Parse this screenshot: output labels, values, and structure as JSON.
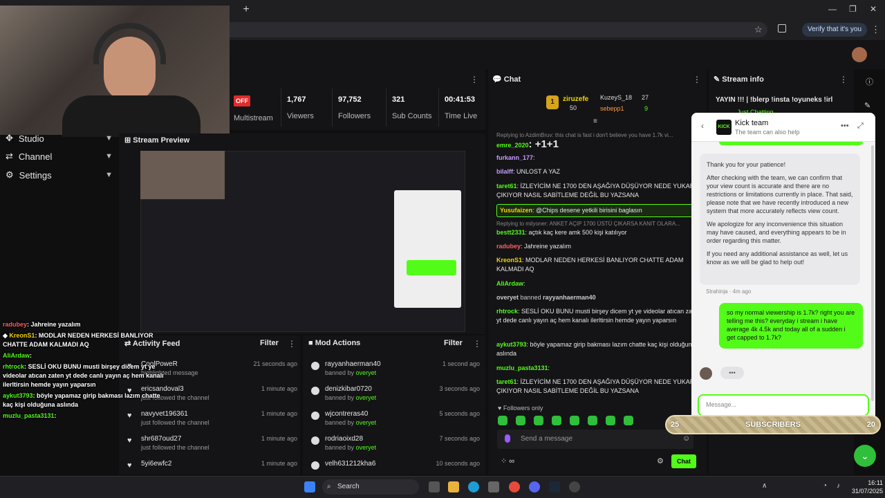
{
  "browser": {
    "new_tab": "+",
    "verify_label": "Verify that it's you",
    "min": "—",
    "max": "❐",
    "close": "✕"
  },
  "nav": {
    "items": [
      {
        "label": "Studio"
      },
      {
        "label": "Channel"
      },
      {
        "label": "Settings"
      }
    ]
  },
  "stats": {
    "status": "OFF",
    "multistream_label": "Multistream",
    "viewers": "1,767",
    "viewers_label": "Viewers",
    "followers": "97,752",
    "followers_label": "Followers",
    "subs": "321",
    "subs_label": "Sub Counts",
    "time": "00:41:53",
    "time_label": "Time Live"
  },
  "preview": {
    "title": "Stream Preview"
  },
  "activity": {
    "title": "Activity Feed",
    "filter": "Filter",
    "rows": [
      {
        "name": "CoolPoweR",
        "sub": "highlighted message",
        "time": "21 seconds ago"
      },
      {
        "name": "ericsandoval3",
        "sub": "just followed the channel",
        "time": "1 minute ago"
      },
      {
        "name": "navyvet196361",
        "sub": "just followed the channel",
        "time": "1 minute ago"
      },
      {
        "name": "shr687oud27",
        "sub": "just followed the channel",
        "time": "1 minute ago"
      },
      {
        "name": "5yi6ewfc2",
        "sub": "",
        "time": "1 minute ago"
      }
    ]
  },
  "mod": {
    "title": "Mod Actions",
    "filter": "Filter",
    "banned_by": "banned by",
    "moderator": "overyet",
    "rows": [
      {
        "name": "rayyanhaerman40",
        "time": "1 second ago"
      },
      {
        "name": "denizkibar0720",
        "time": "3 seconds ago"
      },
      {
        "name": "wjcontreras40",
        "time": "5 seconds ago"
      },
      {
        "name": "rodriaoixd28",
        "time": "7 seconds ago"
      },
      {
        "name": "velh631212kha6",
        "time": "10 seconds ago"
      }
    ]
  },
  "overlay": [
    {
      "user": "radubey",
      "text": ": Jahreine yazalım"
    },
    {
      "user": "KreonS1",
      "text": ": MODLAR NEDEN HERKESİ BANLIYOR CHATTE ADAM KALMADI AQ"
    },
    {
      "user": "AliArdaw",
      "text": ":"
    },
    {
      "user": "rhtrock",
      "text": ": SESLİ OKU BUNU musti birşey dicem yt ye videolar atıcan zaten yt dede canlı yayın aç hem kanalı ilerltirsin hemde yayın yaparsın"
    },
    {
      "user": "aykut3793",
      "text": ": böyle yapamaz girip bakması lazım chatte kaç kişi olduğuna aslında"
    },
    {
      "user": "muzlu_pasta3131",
      "text": ":"
    }
  ],
  "chat": {
    "title": "Chat",
    "top": [
      {
        "rank": "1",
        "name": "ziruzefe",
        "count": "50"
      },
      {
        "rank": "",
        "name": "KuzeyS_18",
        "count": "27"
      },
      {
        "rank": "",
        "name": "sebepp1",
        "count": "9"
      }
    ],
    "messages": [
      {
        "reply": "Replying to AzdimBruv: this chat is fast i don't believe you have 1.7k vi...",
        "user": "emre_2020",
        "text": ": +1+1"
      },
      {
        "user": "furkann_177",
        "text": ":"
      },
      {
        "user": "bilalff",
        "text": ": UNLOST A YAZ"
      },
      {
        "user": "taret61",
        "text": ": İZLEYİCİM NE 1700 DEN AŞAĞIYA DÜŞÜYOR NEDE YUKARI ÇIKIYOR NASIL SABİTLEME DEĞİL BU YAZSANA"
      },
      {
        "user": "Yusufaizen",
        "text": ": @Chips desene yetkili birisini baglasın",
        "highlight": true
      },
      {
        "reply": "Replying to milyoner: ANKET AÇIP 1700 ÜSTÜ ÇIKARSA KANIT OLARA...",
        "user": "bestt2331",
        "text": ": açtık kaç kere amk 500 kişi katılıyor"
      },
      {
        "user": "radubey",
        "text": ": Jahreine yazalım"
      },
      {
        "user": "KreonS1",
        "text": ": MODLAR NEDEN HERKESİ BANLIYOR CHATTE ADAM KALMADI AQ"
      },
      {
        "user": "AliArdaw",
        "text": ":"
      },
      {
        "system": true,
        "user": "overyet",
        "text": "banned",
        "target": "rayyanhaerman40"
      },
      {
        "user": "rhtrock",
        "text": ": SESLİ OKU BUNU musti birşey dicem yt ye videolar atıcan zaten yt dede canlı yayın aç hem kanalı ilerltirsin hemde yayın yaparsın"
      },
      {
        "user": "aykut3793",
        "text": ": böyle yapamaz girip bakması lazım chatte kaç kişi olduğuna aslında"
      },
      {
        "user": "muzlu_pasta3131",
        "text": ":"
      },
      {
        "user": "taret61",
        "text": ": İZLEYİCİM NE 1700 DEN AŞAĞIYA DÜŞÜYOR NEDE YUKARI ÇIKIYOR NASIL SABİTLEME DEĞİL BU YAZSANA"
      }
    ],
    "followers_only": "Followers only",
    "send_placeholder": "Send a message",
    "chat_button": "Chat"
  },
  "info": {
    "title": "Stream info",
    "stream_title": "YAYIN !!! | !blerp !insta !oyuneks !irl",
    "category": "Just Chatting"
  },
  "widget": {
    "title": "Kick team",
    "subtitle": "The team can also help",
    "logo": "KICK",
    "reply": [
      "Thank you for your patience!",
      "After checking with the team, we can confirm that your view count is accurate and there are no restrictions or limitations currently in place. That said, please note that we have recently introduced a new system that more accurately reflects view count.",
      "We apologize for any inconvenience this situation may have caused, and everything appears to be in order regarding this matter.",
      "If you need any additional assistance as well, let us know as we will be glad to help out!"
    ],
    "meta": "Strahinja · 4m ago",
    "user_msg": "so my normal viewership is 1.7k? right you are telling me this? everyday i stream i have average 4k 4.5k and today all of a sudden i get capped to 1.7k?",
    "typing": "•••",
    "input_placeholder": "Message..."
  },
  "subs": {
    "left": "25",
    "label": "SUBSCRIBERS",
    "right": "20"
  },
  "taskbar": {
    "search": "Search",
    "time": "16:11",
    "date": "31/07/2025"
  },
  "colors": {
    "kick_green": "#53fc18",
    "dark_bg": "#0f0f10",
    "panel_bg": "#141416"
  }
}
